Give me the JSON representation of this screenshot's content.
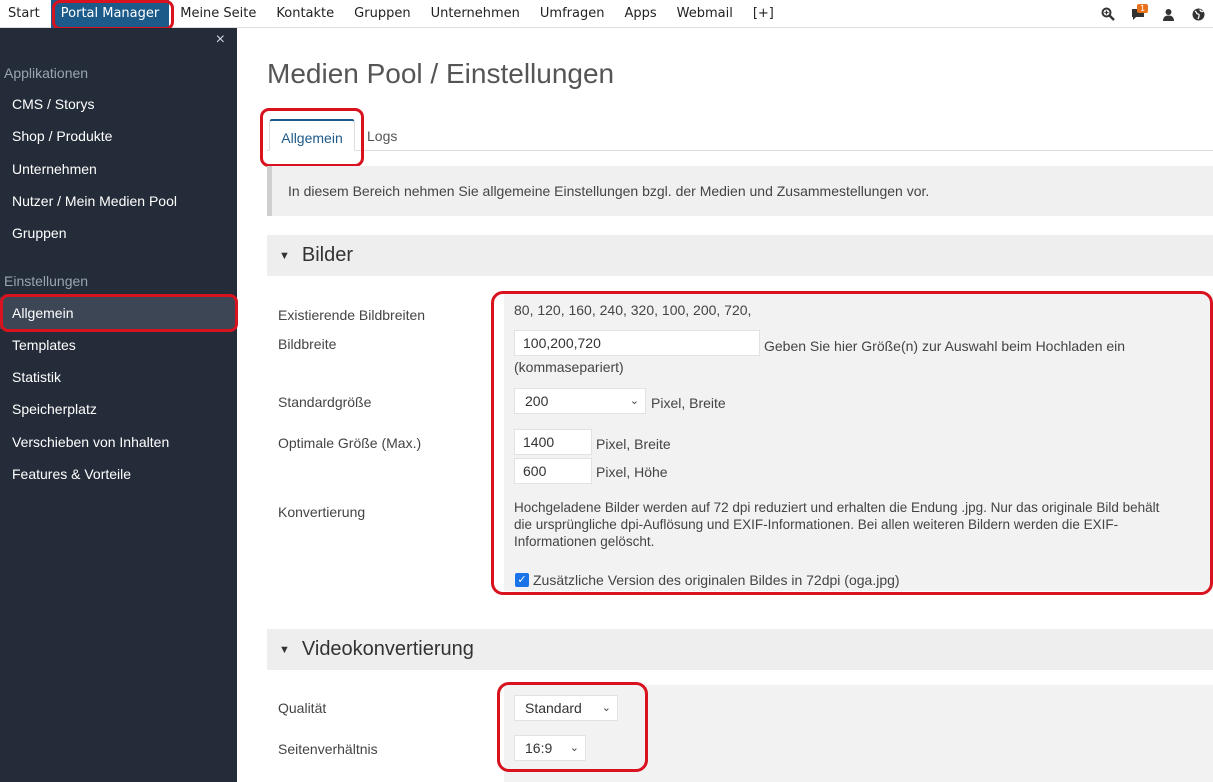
{
  "topnav": {
    "items": [
      "Start",
      "Portal Manager",
      "Meine Seite",
      "Kontakte",
      "Gruppen",
      "Unternehmen",
      "Umfragen",
      "Apps",
      "Webmail",
      "[+]"
    ],
    "active_index": 1,
    "icons": [
      "search-icon",
      "chat-icon",
      "user-icon",
      "globe-icon"
    ],
    "chat_badge": "1"
  },
  "sidebar": {
    "close_label": "×",
    "heading_apps": "Applikationen",
    "apps": [
      "CMS / Storys",
      "Shop / Produkte",
      "Unternehmen",
      "Nutzer / Mein Medien Pool",
      "Gruppen"
    ],
    "heading_settings": "Einstellungen",
    "settings": [
      "Allgemein",
      "Templates",
      "Statistik",
      "Speicherplatz",
      "Verschieben von Inhalten",
      "Features & Vorteile"
    ],
    "active_setting": "Allgemein"
  },
  "page": {
    "title": "Medien Pool / Einstellungen",
    "tabs": {
      "general": "Allgemein",
      "logs": "Logs"
    },
    "info": "In diesem Bereich nehmen Sie allgemeine Einstellungen bzgl. der Medien und Zusammestellungen vor."
  },
  "bilder": {
    "title": "Bilder",
    "existing_label": "Existierende Bildbreiten",
    "existing_value": "80, 120, 160, 240, 320, 100, 200, 720,",
    "width_label": "Bildbreite",
    "width_value": "100,200,720",
    "width_help_1": "Geben Sie hier Größe(n) zur Auswahl beim Hochladen ein",
    "width_help_2": "(kommasepariert)",
    "std_label": "Standardgröße",
    "std_value": "200",
    "std_unit": "Pixel, Breite",
    "opt_label": "Optimale Größe (Max.)",
    "opt_width": "1400",
    "opt_width_unit": "Pixel, Breite",
    "opt_height": "600",
    "opt_height_unit": "Pixel, Höhe",
    "conv_label": "Konvertierung",
    "conv_text_1": "Hochgeladene Bilder werden auf 72 dpi reduziert und erhalten die Endung .jpg. Nur das originale Bild behält",
    "conv_text_2": "die ursprüngliche dpi-Auflösung und EXIF-Informationen. Bei allen weiteren Bildern werden die EXIF-",
    "conv_text_3": "Informationen gelöscht.",
    "checkbox_label": "Zusätzliche Version des originalen Bildes in 72dpi (oga.jpg)",
    "checkbox_checked": true
  },
  "video": {
    "title": "Videokonvertierung",
    "quality_label": "Qualität",
    "quality_value": "Standard",
    "ratio_label": "Seitenverhältnis",
    "ratio_value": "16:9"
  },
  "colors": {
    "accent": "#1c5a8a",
    "sidebar_bg": "#232c38",
    "annotation": "#d8121e"
  }
}
